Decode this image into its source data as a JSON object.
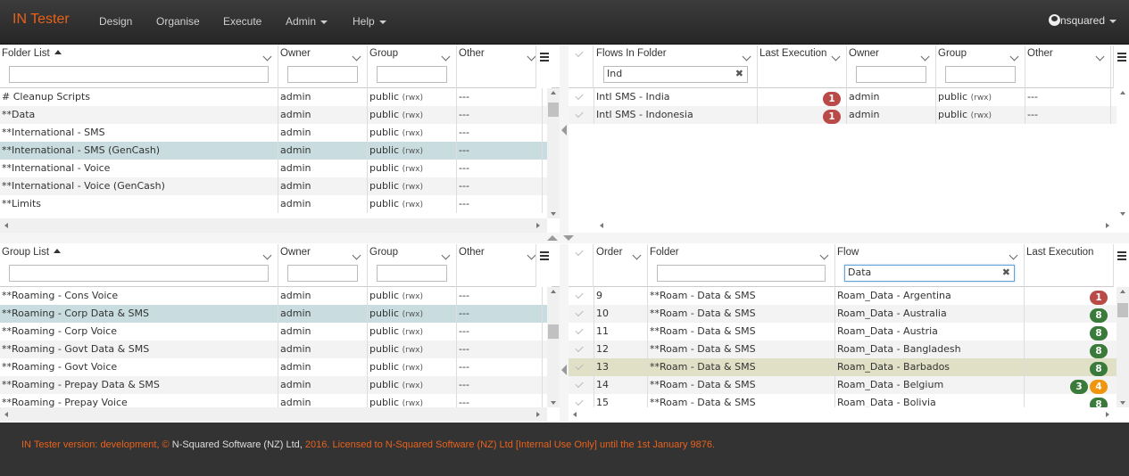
{
  "app": {
    "brand": "IN Tester"
  },
  "nav": {
    "design": "Design",
    "organise": "Organise",
    "execute": "Execute",
    "admin": "Admin",
    "help": "Help"
  },
  "user": {
    "name": "nsquared"
  },
  "folder_grid": {
    "columns": [
      "Folder List",
      "Owner",
      "Group",
      "Other"
    ],
    "rows": [
      [
        "# Cleanup Scripts",
        "admin",
        "public",
        "(rwx)",
        "---"
      ],
      [
        "**Data",
        "admin",
        "public",
        "(rwx)",
        "---"
      ],
      [
        "**International - SMS",
        "admin",
        "public",
        "(rwx)",
        "---"
      ],
      [
        "**International - SMS (GenCash)",
        "admin",
        "public",
        "(rwx)",
        "---"
      ],
      [
        "**International - Voice",
        "admin",
        "public",
        "(rwx)",
        "---"
      ],
      [
        "**International - Voice (GenCash)",
        "admin",
        "public",
        "(rwx)",
        "---"
      ],
      [
        "**Limits",
        "admin",
        "public",
        "(rwx)",
        "---"
      ]
    ],
    "selected_row": 3
  },
  "flows_grid": {
    "columns": [
      "Flows In Folder",
      "Last Execution",
      "Owner",
      "Group",
      "Other"
    ],
    "filter": "Ind",
    "rows": [
      [
        "Intl SMS - India",
        "1",
        "admin",
        "public",
        "(rwx)",
        "---"
      ],
      [
        "Intl SMS - Indonesia",
        "1",
        "admin",
        "public",
        "(rwx)",
        "---"
      ]
    ]
  },
  "group_grid": {
    "columns": [
      "Group List",
      "Owner",
      "Group",
      "Other"
    ],
    "rows": [
      [
        "**Roaming - Cons Voice",
        "admin",
        "public",
        "(rwx)",
        "---"
      ],
      [
        "**Roaming - Corp Data & SMS",
        "admin",
        "public",
        "(rwx)",
        "---"
      ],
      [
        "**Roaming - Corp Voice",
        "admin",
        "public",
        "(rwx)",
        "---"
      ],
      [
        "**Roaming - Govt Data & SMS",
        "admin",
        "public",
        "(rwx)",
        "---"
      ],
      [
        "**Roaming - Govt Voice",
        "admin",
        "public",
        "(rwx)",
        "---"
      ],
      [
        "**Roaming - Prepay Data & SMS",
        "admin",
        "public",
        "(rwx)",
        "---"
      ],
      [
        "**Roaming - Prepay Voice",
        "admin",
        "public",
        "(rwx)",
        "---"
      ]
    ],
    "selected_row": 1
  },
  "order_grid": {
    "columns": [
      "Order",
      "Folder",
      "Flow",
      "Last Execution"
    ],
    "filter": "Data",
    "rows": [
      {
        "order": "9",
        "folder": "**Roam - Data & SMS",
        "flow": "Roam_Data - Argentina",
        "badges": [
          [
            "1",
            "red"
          ]
        ]
      },
      {
        "order": "10",
        "folder": "**Roam - Data & SMS",
        "flow": "Roam_Data - Australia",
        "badges": [
          [
            "8",
            "green"
          ]
        ]
      },
      {
        "order": "11",
        "folder": "**Roam - Data & SMS",
        "flow": "Roam_Data - Austria",
        "badges": [
          [
            "8",
            "green"
          ]
        ]
      },
      {
        "order": "12",
        "folder": "**Roam - Data & SMS",
        "flow": "Roam_Data - Bangladesh",
        "badges": [
          [
            "8",
            "green"
          ]
        ]
      },
      {
        "order": "13",
        "folder": "**Roam - Data & SMS",
        "flow": "Roam_Data - Barbados",
        "badges": [
          [
            "8",
            "green"
          ]
        ]
      },
      {
        "order": "14",
        "folder": "**Roam - Data & SMS",
        "flow": "Roam_Data - Belgium",
        "badges": [
          [
            "3",
            "green"
          ],
          [
            "4",
            "orange"
          ]
        ]
      },
      {
        "order": "15",
        "folder": "**Roam - Data & SMS",
        "flow": "Roam_Data - Bolivia",
        "badges": [
          [
            "8",
            "green"
          ]
        ]
      }
    ],
    "highlighted_row": 4
  },
  "footer": {
    "part1": "IN Tester version: development, ©",
    "part2": " N-Squared Software (NZ) Ltd,",
    "part3": " 2016. Licensed to N-Squared Software (NZ) Ltd [Internal Use Only] until the 1st January 9876."
  },
  "colors": {
    "brand": "#e8611c",
    "selected_row": "#c9dde0",
    "highlight_row": "#dfe0c6",
    "badge_red": "#b94a48",
    "badge_green": "#3a7a3a",
    "badge_orange": "#f0960e"
  }
}
